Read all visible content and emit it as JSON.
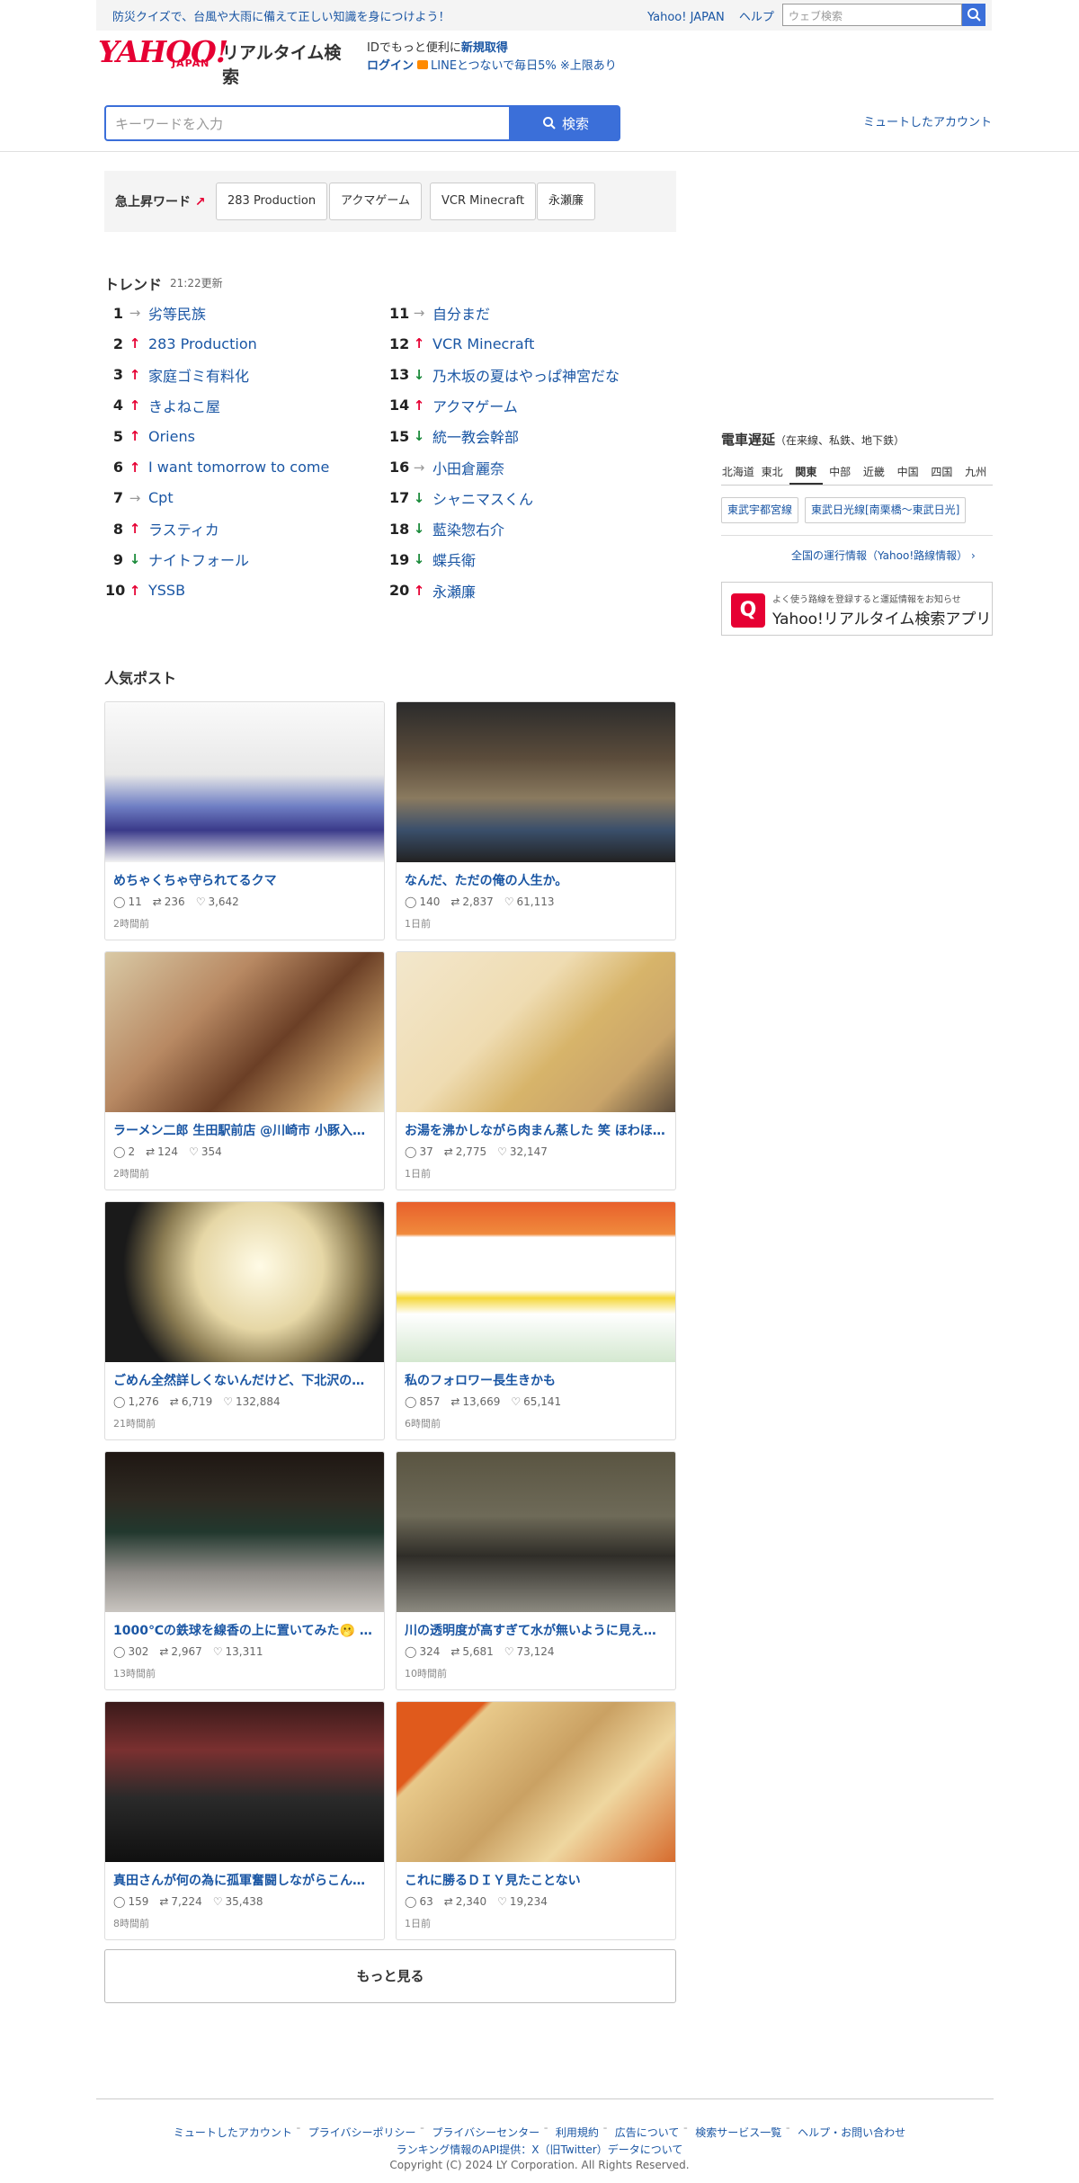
{
  "topbar": {
    "promo": "防災クイズで、台風や大雨に備えて正しい知識を身につけよう！",
    "yahoo_japan": "Yahoo! JAPAN",
    "help": "ヘルプ",
    "web_search_placeholder": "ウェブ検索"
  },
  "logo": {
    "brand": "YAHOO!",
    "japan": "JAPAN",
    "service": "リアルタイム検索"
  },
  "header": {
    "id_text": "IDでもっと便利に",
    "register": "新規取得",
    "login": "ログイン",
    "line_promo": "LINEとつないで毎日5% ※上限あり"
  },
  "search": {
    "placeholder": "キーワードを入力",
    "button": "検索",
    "muted_accounts": "ミュートしたアカウント"
  },
  "surge": {
    "label": "急上昇ワード",
    "words": [
      "283 Production",
      "アクマゲーム",
      "VCR Minecraft",
      "永瀬廉"
    ]
  },
  "trends": {
    "title": "トレンド",
    "updated": "21:22更新",
    "items": [
      {
        "rank": "1",
        "trend": "flat",
        "word": "劣等民族"
      },
      {
        "rank": "2",
        "trend": "up",
        "word": "283 Production"
      },
      {
        "rank": "3",
        "trend": "up",
        "word": "家庭ゴミ有料化"
      },
      {
        "rank": "4",
        "trend": "up",
        "word": "きよねこ屋"
      },
      {
        "rank": "5",
        "trend": "up",
        "word": "Oriens"
      },
      {
        "rank": "6",
        "trend": "up",
        "word": "I want tomorrow to come"
      },
      {
        "rank": "7",
        "trend": "flat",
        "word": "Cpt"
      },
      {
        "rank": "8",
        "trend": "up",
        "word": "ラスティカ"
      },
      {
        "rank": "9",
        "trend": "down",
        "word": "ナイトフォール"
      },
      {
        "rank": "10",
        "trend": "up",
        "word": "YSSB"
      },
      {
        "rank": "11",
        "trend": "flat",
        "word": "自分まだ"
      },
      {
        "rank": "12",
        "trend": "up",
        "word": "VCR Minecraft"
      },
      {
        "rank": "13",
        "trend": "down",
        "word": "乃木坂の夏はやっぱ神宮だな"
      },
      {
        "rank": "14",
        "trend": "up",
        "word": "アクマゲーム"
      },
      {
        "rank": "15",
        "trend": "down",
        "word": "統一教会幹部"
      },
      {
        "rank": "16",
        "trend": "flat",
        "word": "小田倉麗奈"
      },
      {
        "rank": "17",
        "trend": "down",
        "word": "シャニマスくん"
      },
      {
        "rank": "18",
        "trend": "down",
        "word": "藍染惣右介"
      },
      {
        "rank": "19",
        "trend": "down",
        "word": "蝶兵衛"
      },
      {
        "rank": "20",
        "trend": "up",
        "word": "永瀬廉"
      }
    ]
  },
  "train": {
    "title": "電車遅延",
    "subtitle": "（在来線、私鉄、地下鉄）",
    "regions": [
      "北海道",
      "東北",
      "関東",
      "中部",
      "近畿",
      "中国",
      "四国",
      "九州"
    ],
    "active_region": "関東",
    "lines": [
      "東武宇都宮線",
      "東武日光線[南栗橋〜東武日光]"
    ],
    "all_link": "全国の運行情報（Yahoo!路線情報） ›",
    "app_small": "よく使う路線を登録すると運延情報をお知らせ",
    "app_big": "Yahoo!リアルタイム検索アプリ"
  },
  "posts": {
    "title": "人気ポスト",
    "items": [
      {
        "title": "めちゃくちゃ守られてるクマ",
        "replies": "11",
        "reposts": "236",
        "likes": "3,642",
        "time": "2時間前"
      },
      {
        "title": "なんだ、ただの俺の人生か。",
        "replies": "140",
        "reposts": "2,837",
        "likes": "61,113",
        "time": "1日前"
      },
      {
        "title": "ラーメン二郎 生田駅前店 @川崎市 小豚入り…",
        "replies": "2",
        "reposts": "124",
        "likes": "354",
        "time": "2時間前"
      },
      {
        "title": "お湯を沸かしながら肉まん蒸した 笑 ほわほ…",
        "replies": "37",
        "reposts": "2,775",
        "likes": "32,147",
        "time": "1日前"
      },
      {
        "title": "ごめん全然詳しくないんだけど、下北沢の…",
        "replies": "1,276",
        "reposts": "6,719",
        "likes": "132,884",
        "time": "21時間前"
      },
      {
        "title": "私のフォロワー長生きかも",
        "replies": "857",
        "reposts": "13,669",
        "likes": "65,141",
        "time": "6時間前"
      },
      {
        "title": "1000℃の鉄球を線香の上に置いてみた🫢 え…",
        "replies": "302",
        "reposts": "2,967",
        "likes": "13,311",
        "time": "13時間前"
      },
      {
        "title": "川の透明度が高すぎて水が無いように見え…",
        "replies": "324",
        "reposts": "5,681",
        "likes": "73,124",
        "time": "10時間前"
      },
      {
        "title": "真田さんが何の為に孤軍奮闘しながらこん…",
        "replies": "159",
        "reposts": "7,224",
        "likes": "35,438",
        "time": "8時間前"
      },
      {
        "title": "これに勝るＤＩＹ見たことない",
        "replies": "63",
        "reposts": "2,340",
        "likes": "19,234",
        "time": "1日前"
      }
    ],
    "more": "もっと見る"
  },
  "footer": {
    "links": [
      "ミュートしたアカウント",
      "プライバシーポリシー",
      "プライバシーセンター",
      "利用規約",
      "広告について",
      "検索サービス一覧",
      "ヘルプ・お問い合わせ"
    ],
    "api_credit": "ランキング情報のAPI提供：X（旧Twitter）データについて",
    "copyright": "Copyright (C) 2024 LY Corporation. All Rights Reserved."
  }
}
